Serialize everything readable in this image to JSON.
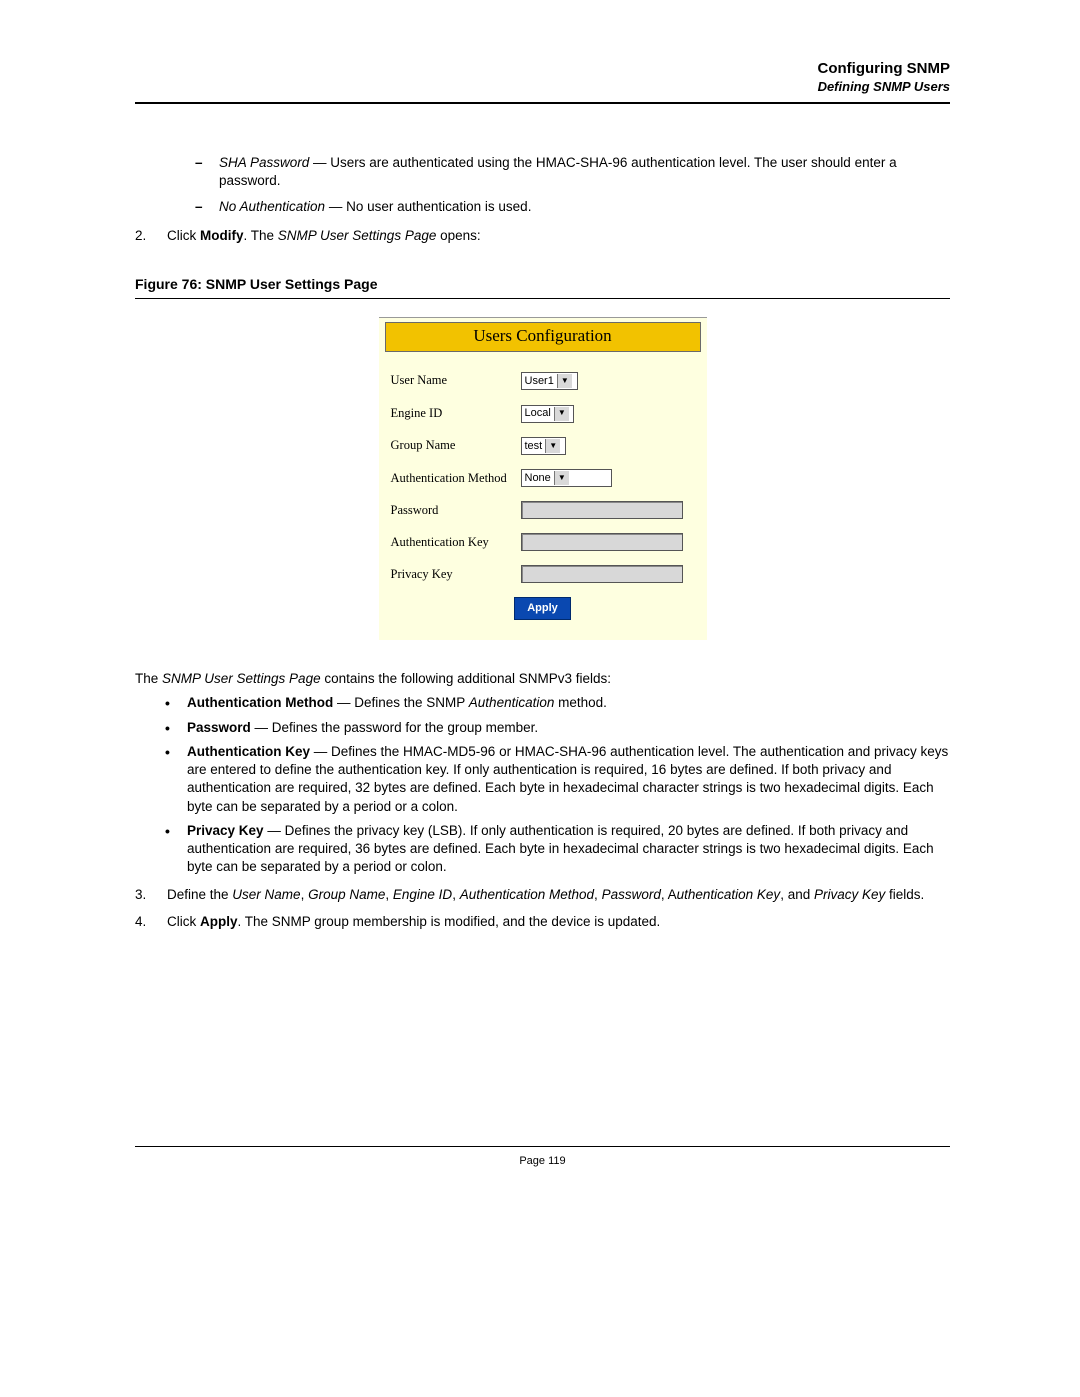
{
  "header": {
    "title": "Configuring SNMP",
    "subtitle": "Defining SNMP Users"
  },
  "top_items": {
    "sha_label": "SHA Password",
    "sha_text": " — Users are authenticated using the HMAC-SHA-96 authentication level. The user should enter a password.",
    "noauth_label": "No Authentication",
    "noauth_text": " — No user authentication is used."
  },
  "step2": {
    "num": "2.",
    "pre": "Click ",
    "bold": "Modify",
    "mid": ". The ",
    "ital": "SNMP User Settings Page",
    "post": " opens:"
  },
  "figure_caption": "Figure 76:  SNMP User Settings Page",
  "screenshot": {
    "title": "Users Configuration",
    "rows": {
      "username_label": "User Name",
      "username_value": "User1",
      "engine_label": "Engine ID",
      "engine_value": "Local",
      "group_label": "Group Name",
      "group_value": "test",
      "auth_label": "Authentication Method",
      "auth_value": "None",
      "password_label": "Password",
      "authkey_label": "Authentication Key",
      "privkey_label": "Privacy Key"
    },
    "apply": "Apply"
  },
  "para_intro": {
    "pre": "The ",
    "ital": "SNMP User Settings Page",
    "post": " contains the following additional SNMPv3 fields:"
  },
  "bullets": {
    "b1_bold": "Authentication Method",
    "b1_mid": " — Defines the SNMP ",
    "b1_ital": "Authentication",
    "b1_post": " method.",
    "b2_bold": "Password",
    "b2_text": " — Defines the password for the group member.",
    "b3_bold": "Authentication Key",
    "b3_text": " — Defines the HMAC-MD5-96 or HMAC-SHA-96 authentication level. The authentication and privacy keys are entered to define the authentication key. If only authentication is required, 16 bytes are defined. If both privacy and authentication are required, 32 bytes are defined. Each byte in hexadecimal character strings is two hexadecimal digits. Each byte can be separated by a period or a colon.",
    "b4_bold": "Privacy Key",
    "b4_text": " — Defines the privacy key (LSB). If only authentication is required, 20 bytes are defined. If both privacy and authentication are required, 36 bytes are defined. Each byte in hexadecimal character strings is two hexadecimal digits. Each byte can be separated by a period or colon."
  },
  "step3": {
    "num": "3.",
    "pre": "Define the ",
    "i1": "User Name",
    "c1": ", ",
    "i2": "Group Name",
    "c2": ", ",
    "i3": "Engine ID",
    "c3": ", ",
    "i4": "Authentication Method",
    "c4": ", ",
    "i5": "Password",
    "c5": ", A",
    "i6": "uthentication Key",
    "c6": ", and ",
    "i7": "Privacy Key",
    "post": " fields."
  },
  "step4": {
    "num": "4.",
    "pre": "Click ",
    "bold": "Apply",
    "post": ". The SNMP group membership is modified, and the device is updated."
  },
  "page_number": "Page 119"
}
